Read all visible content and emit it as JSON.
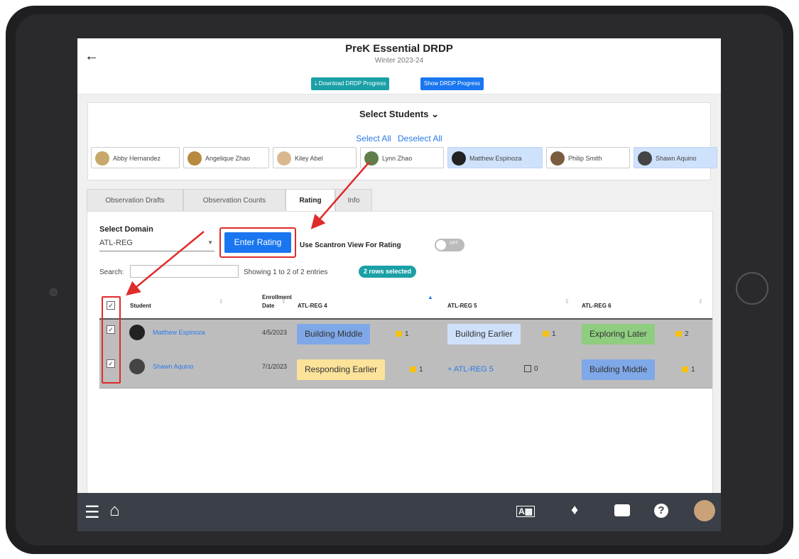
{
  "header": {
    "title": "PreK Essential DRDP",
    "subtitle": "Winter 2023-24",
    "back_icon": "back-arrow-icon"
  },
  "actions": {
    "download_label": "⤓ Download DRDP Progress",
    "show_label": "Show DRDP Progress"
  },
  "students_panel": {
    "title": "Select Students ⌄",
    "select_all": "Select All",
    "deselect_all": "Deselect All",
    "students": [
      {
        "name": "Abby Hernandez",
        "selected": false,
        "avatar_color": "#c7a86a"
      },
      {
        "name": "Angelique Zhao",
        "selected": false,
        "avatar_color": "#b8893e"
      },
      {
        "name": "Kiley Abel",
        "selected": false,
        "avatar_color": "#d8b98f"
      },
      {
        "name": "Lynn Zhao",
        "selected": false,
        "avatar_color": "#5f7d4a"
      },
      {
        "name": "Matthew Espinoza",
        "selected": true,
        "avatar_color": "#222222"
      },
      {
        "name": "Philip Smith",
        "selected": false,
        "avatar_color": "#7a5c3e"
      },
      {
        "name": "Shawn Aquino",
        "selected": true,
        "avatar_color": "#444444"
      }
    ]
  },
  "tabs": [
    {
      "label": "Observation Drafts",
      "active": false
    },
    {
      "label": "Observation Counts",
      "active": false
    },
    {
      "label": "Rating",
      "active": true
    },
    {
      "label": "Info",
      "active": false
    }
  ],
  "rating": {
    "domain_label": "Select Domain",
    "domain_value": "ATL-REG",
    "enter_rating_label": "Enter Rating",
    "scantron_label": "Use Scantron View For Rating",
    "toggle_text": "OFF",
    "search_label": "Search:",
    "showing_text": "Showing 1 to 2 of 2 entries",
    "rows_selected": "2 rows selected"
  },
  "table": {
    "headers": {
      "student": "Student",
      "enrollment_line1": "Enrollment",
      "enrollment_line2": "Date",
      "col1": "ATL-REG 4",
      "col2": "ATL-REG 5",
      "col3": "ATL-REG 6"
    },
    "rows": [
      {
        "name": "Matthew Espinoza",
        "date": "4/5/2023",
        "c1": "Building Middle",
        "c1_notes": "1",
        "c2": "Building Earlier",
        "c2_notes": "1",
        "c3": "Exploring Later",
        "c3_notes": "2"
      },
      {
        "name": "Shawn Aquino",
        "date": "7/1/2023",
        "c1": "Responding Earlier",
        "c1_notes": "1",
        "c2": "+ ATL-REG 5",
        "c2_notes": "0",
        "c3": "Building Middle",
        "c3_notes": "1"
      }
    ]
  },
  "colors": {
    "accent_blue": "#1976f0",
    "teal": "#1aa0a6",
    "annotation_red": "#e02b2b",
    "bottom_bar": "#3b3f47"
  },
  "bottom_bar": {
    "icons": [
      "menu-icon",
      "home-icon",
      "translate-icon",
      "bell-icon",
      "chat-icon",
      "help-icon",
      "user-avatar"
    ]
  }
}
